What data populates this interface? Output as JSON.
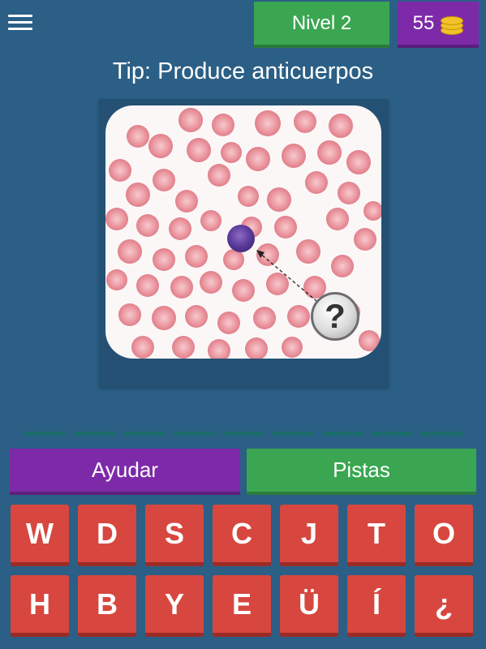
{
  "header": {
    "level_label": "Nivel 2",
    "coins": "55"
  },
  "tip": "Tip: Produce anticuerpos",
  "image": {
    "description_icon": "question-mark-hint-icon",
    "hint_symbol": "?"
  },
  "answer_slots": 9,
  "actions": {
    "help_label": "Ayudar",
    "hints_label": "Pistas"
  },
  "keyboard": {
    "keys": [
      "W",
      "D",
      "S",
      "C",
      "J",
      "T",
      "O",
      "H",
      "B",
      "Y",
      "E",
      "Ü",
      "Í",
      "¿"
    ]
  },
  "colors": {
    "background": "#2b5f86",
    "green": "#3aa651",
    "purple": "#7d2aa8",
    "key_red": "#d7473f"
  }
}
